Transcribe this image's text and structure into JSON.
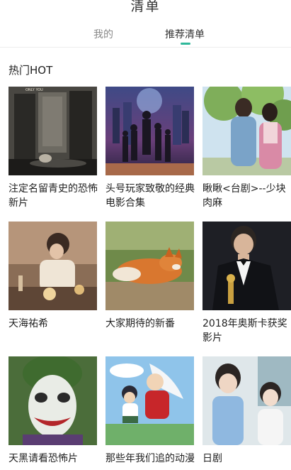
{
  "header": {
    "title": "清单",
    "tabs": [
      {
        "label": "我的",
        "active": false
      },
      {
        "label": "推荐清单",
        "active": true
      }
    ],
    "accent_color": "#2fb89a"
  },
  "section": {
    "title": "热门HOT",
    "items": [
      {
        "caption": "注定名留青史的恐怖新片",
        "thumb_text": "ONLY YOU"
      },
      {
        "caption": "头号玩家致敬的经典电影合集"
      },
      {
        "caption": "瞅瞅<台剧>--少块肉麻"
      },
      {
        "caption": "天海祐希"
      },
      {
        "caption": "大家期待的新番"
      },
      {
        "caption": "2018年奥斯卡获奖影片"
      },
      {
        "caption": "天黑请看恐怖片"
      },
      {
        "caption": "那些年我们追的动漫"
      },
      {
        "caption": "日剧"
      }
    ]
  }
}
